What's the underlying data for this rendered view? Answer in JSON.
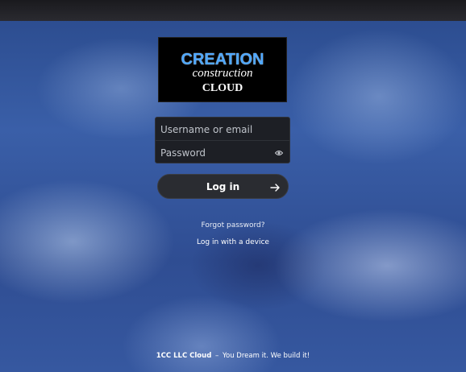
{
  "logo": {
    "line1": "CREATION",
    "line2": "construction",
    "line3": "CLOUD"
  },
  "login_form": {
    "username_placeholder": "Username or email",
    "password_placeholder": "Password",
    "password_toggle_icon": "eye-icon",
    "submit_label": "Log in",
    "submit_icon": "arrow-right-icon"
  },
  "links": {
    "forgot_password": "Forgot password?",
    "device_login": "Log in with a device"
  },
  "footer": {
    "name": "1CC LLC Cloud",
    "separator": "–",
    "slogan": "You Dream it. We build it!"
  },
  "colors": {
    "accent_blue": "#4fa8ff",
    "form_bg": "#1d1f25",
    "button_bg": "#2a2c31"
  }
}
